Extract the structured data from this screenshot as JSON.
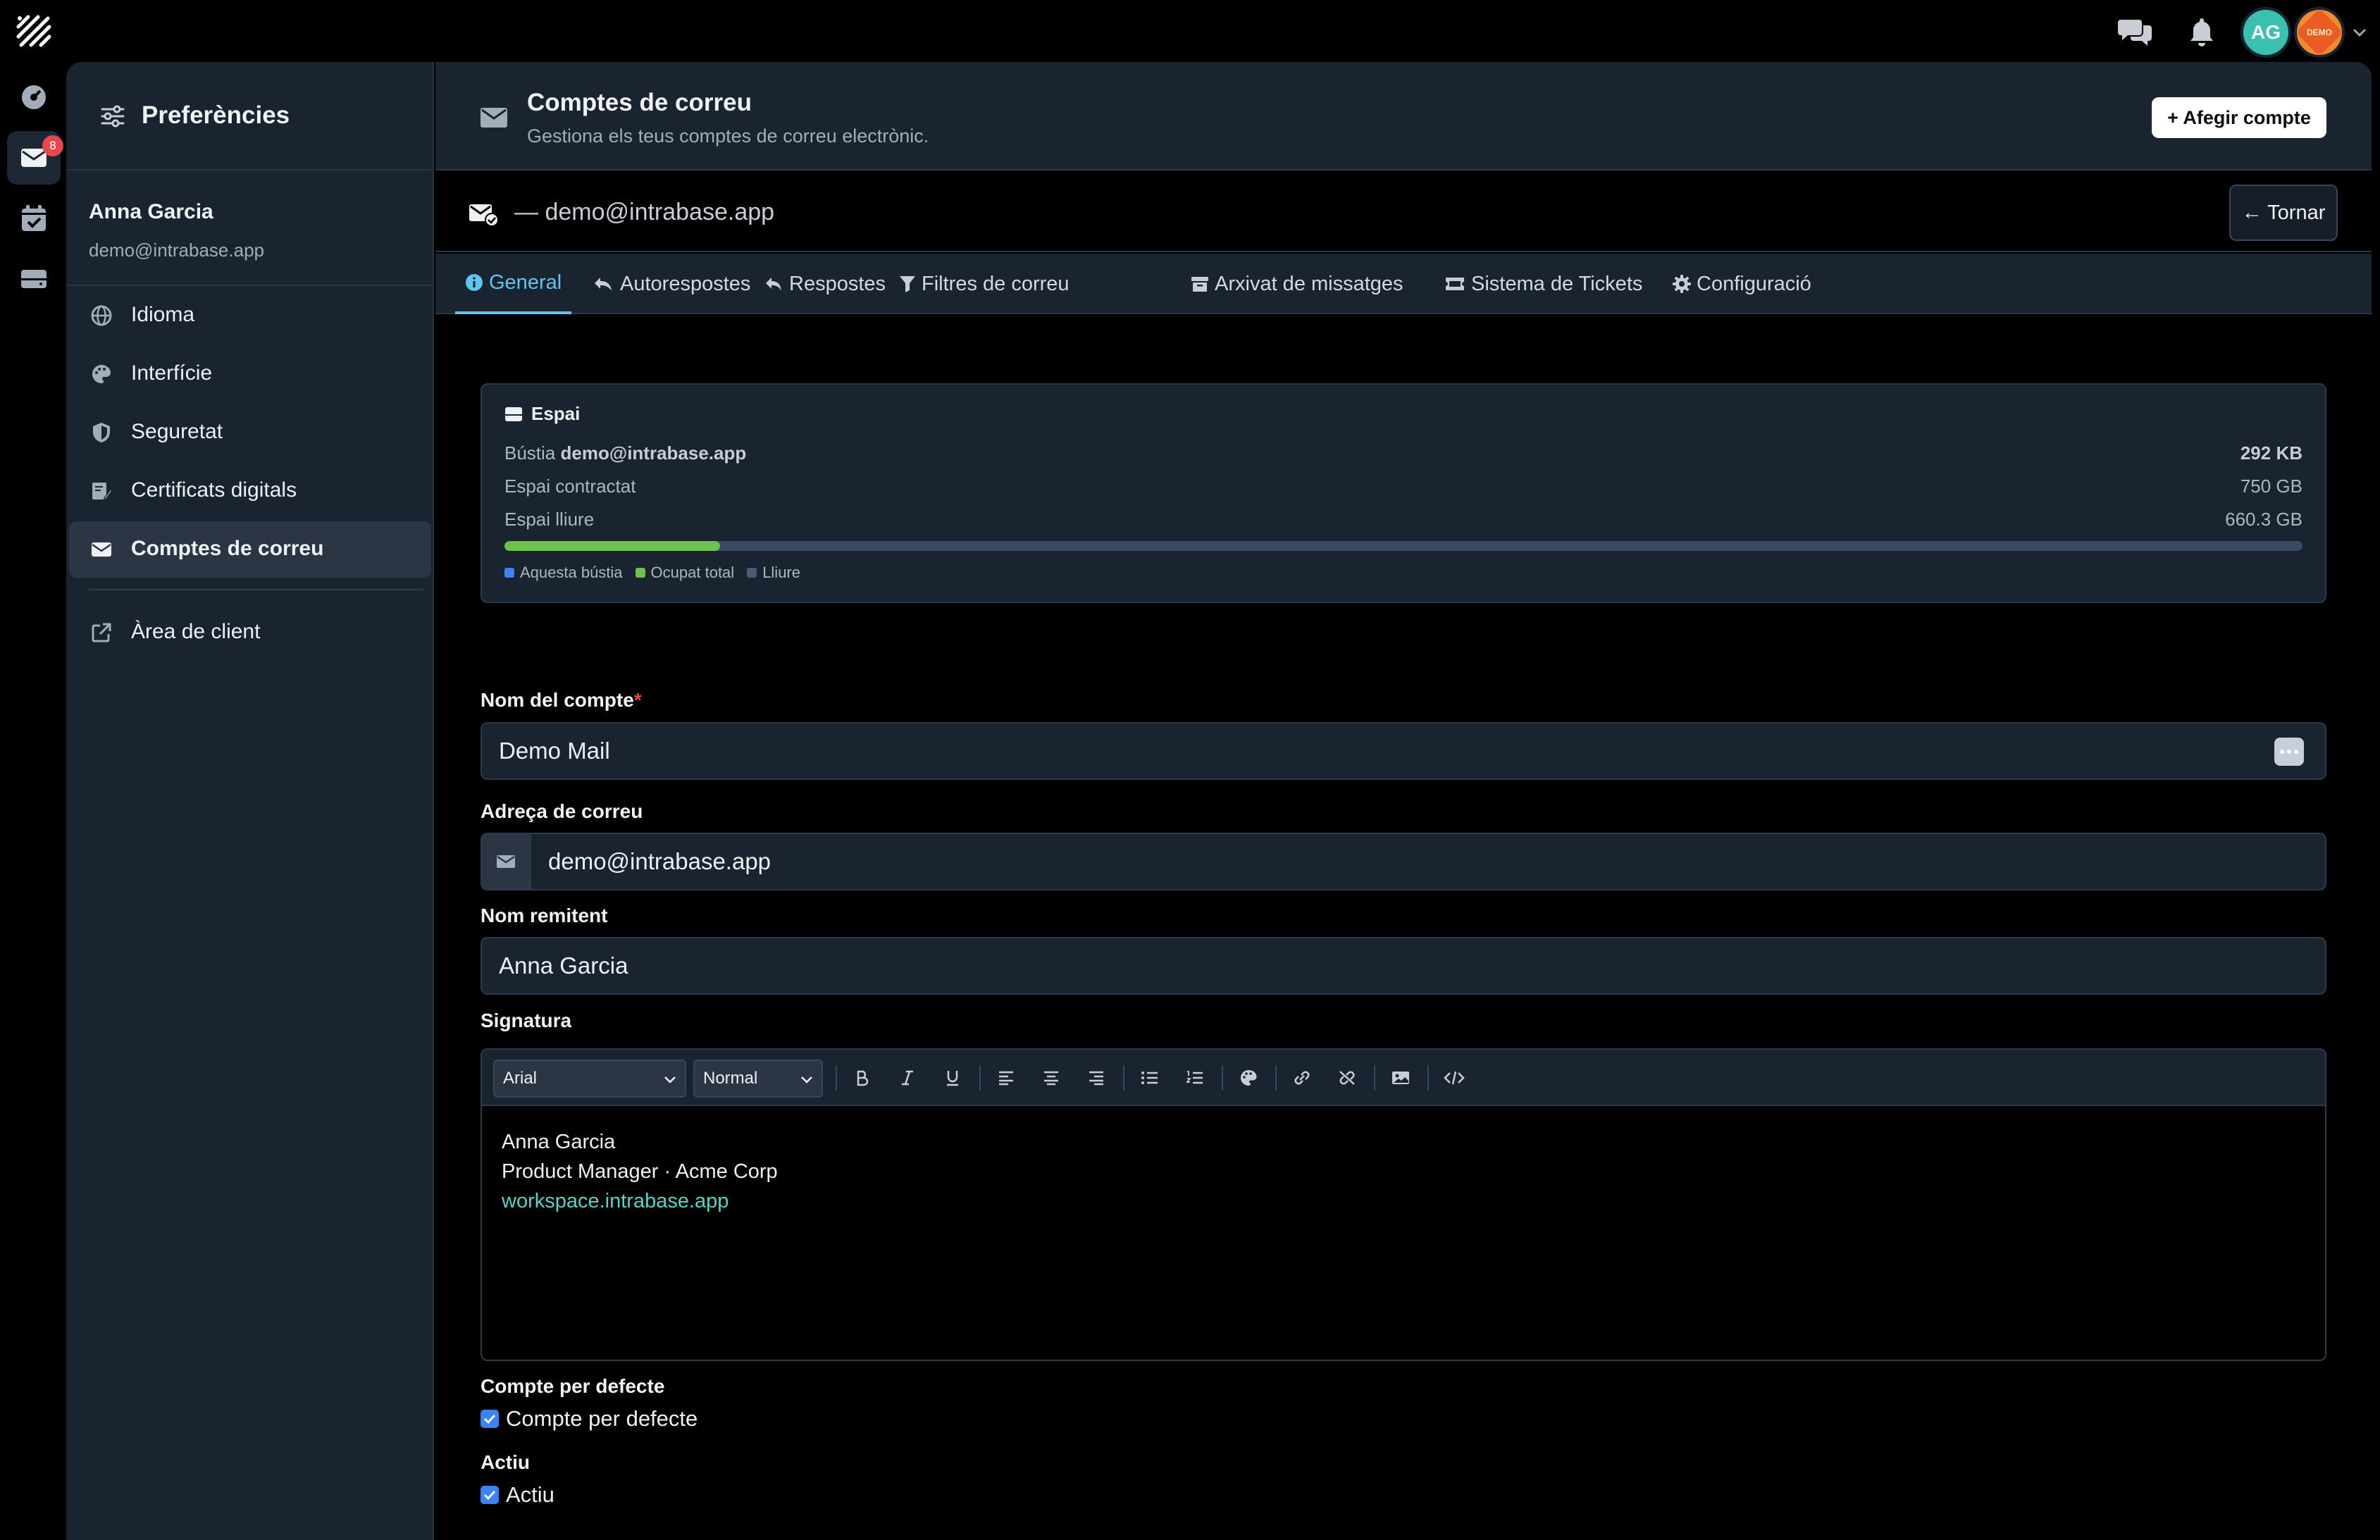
{
  "topbar": {
    "avatar_initials": "AG",
    "demo_badge": "DEMO"
  },
  "rail": {
    "mail_badge": "8"
  },
  "sidebar": {
    "title": "Preferències",
    "user_name": "Anna Garcia",
    "user_email": "demo@intrabase.app",
    "items": [
      {
        "label": "Idioma",
        "icon": "globe-icon"
      },
      {
        "label": "Interfície",
        "icon": "palette-icon"
      },
      {
        "label": "Seguretat",
        "icon": "shield-icon"
      },
      {
        "label": "Certificats digitals",
        "icon": "certificate-icon"
      },
      {
        "label": "Comptes de correu",
        "icon": "envelope-icon",
        "active": true
      },
      {
        "label": "Àrea de client",
        "icon": "external-link-icon"
      }
    ]
  },
  "header": {
    "title": "Comptes de correu",
    "subtitle": "Gestiona els teus comptes de correu electrònic.",
    "add_button": "+ Afegir compte"
  },
  "account_bar": {
    "label": "— demo@intrabase.app",
    "back_button": "← Tornar"
  },
  "tabs": [
    {
      "label": "General",
      "icon": "info-icon",
      "active": true
    },
    {
      "label": "Autorespostes",
      "icon": "reply-all-icon"
    },
    {
      "label": "Respostes",
      "icon": "reply-icon"
    },
    {
      "label": "Filtres de correu",
      "icon": "filter-icon"
    },
    {
      "label": "Arxivat de missatges",
      "icon": "archive-icon"
    },
    {
      "label": "Sistema de Tickets",
      "icon": "ticket-icon"
    },
    {
      "label": "Configuració",
      "icon": "gear-icon"
    }
  ],
  "space": {
    "title": "Espai",
    "mailbox_prefix": "Bústia",
    "mailbox_address": "demo@intrabase.app",
    "mailbox_value": "292 KB",
    "contracted_label": "Espai contractat",
    "contracted_value": "750 GB",
    "free_label": "Espai lliure",
    "free_value": "660.3 GB",
    "used_fraction": 0.12,
    "legend": [
      {
        "label": "Aquesta bústia",
        "color": "#3b82f6"
      },
      {
        "label": "Ocupat total",
        "color": "#6cc24a"
      },
      {
        "label": "Lliure",
        "color": "#4a5a75"
      }
    ]
  },
  "form": {
    "account_name_label": "Nom del compte",
    "required_mark": "*",
    "account_name_value": "Demo Mail",
    "email_label": "Adreça de correu",
    "email_value": "demo@intrabase.app",
    "sender_label": "Nom remitent",
    "sender_value": "Anna Garcia",
    "signature_label": "Signatura",
    "font_select": "Arial",
    "size_select": "Normal",
    "signature_lines": [
      "Anna Garcia",
      "Product Manager · Acme Corp"
    ],
    "signature_link": "workspace.intrabase.app",
    "default_section_label": "Compte per defecte",
    "default_checkbox_label": "Compte per defecte",
    "active_section_label": "Actiu",
    "active_checkbox_label": "Actiu"
  }
}
